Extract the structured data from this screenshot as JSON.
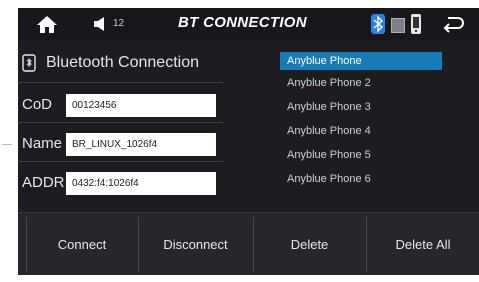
{
  "header": {
    "title": "BT CONNECTION",
    "volume_level": "12",
    "icons": {
      "home": "home-icon",
      "volume": "speaker-icon",
      "bluetooth": "bluetooth-status-icon",
      "box": "storage-status-icon",
      "phone": "phone-status-icon",
      "back": "back-arrow-icon"
    }
  },
  "panel": {
    "title": "Bluetooth Connection",
    "fields": [
      {
        "label": "CoD",
        "value": "00123456"
      },
      {
        "label": "Name",
        "value": "BR_LINUX_1026f4"
      },
      {
        "label": "ADDR",
        "value": "0432:f4:1026f4"
      }
    ]
  },
  "devices": [
    {
      "name": "Anyblue Phone",
      "selected": true
    },
    {
      "name": "Anyblue Phone 2",
      "selected": false
    },
    {
      "name": "Anyblue Phone 3",
      "selected": false
    },
    {
      "name": "Anyblue Phone 4",
      "selected": false
    },
    {
      "name": "Anyblue Phone 5",
      "selected": false
    },
    {
      "name": "Anyblue Phone 6",
      "selected": false
    }
  ],
  "actions": {
    "connect": "Connect",
    "disconnect": "Disconnect",
    "delete": "Delete",
    "delete_all": "Delete All"
  },
  "colors": {
    "background": "#1b1d20",
    "selected": "#177bb8",
    "bluetooth": "#2f7fe0",
    "text": "#e6e6e6"
  }
}
